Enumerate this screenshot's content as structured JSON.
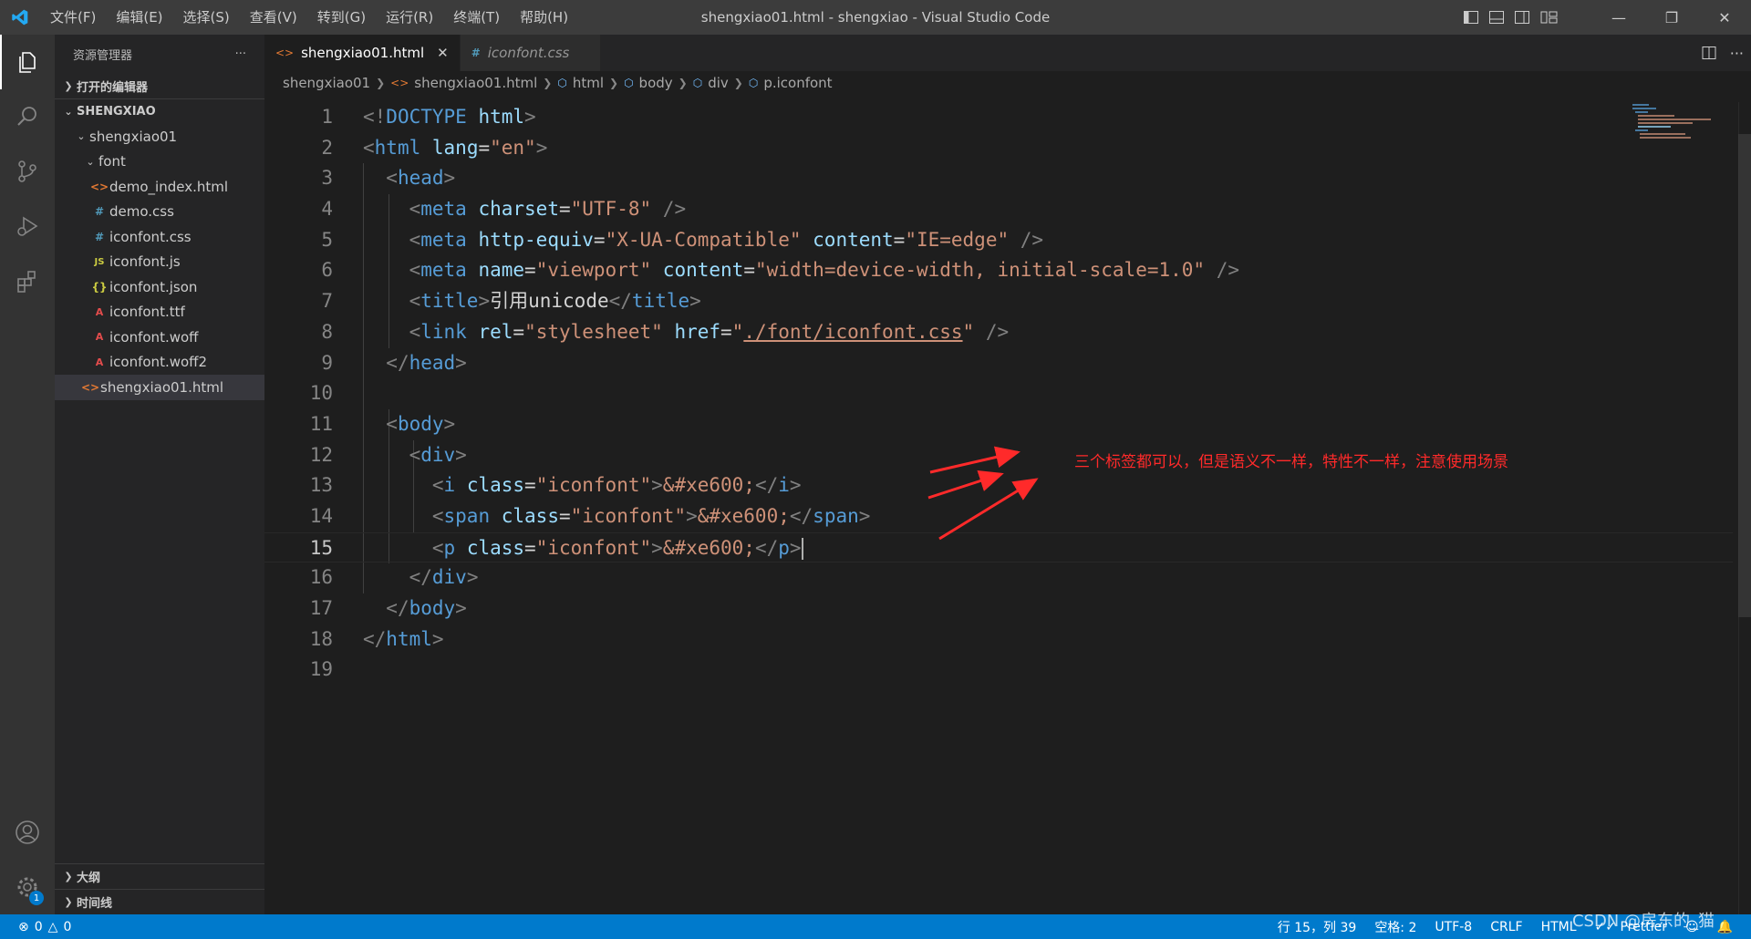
{
  "titlebar": {
    "menu": [
      "文件(F)",
      "编辑(E)",
      "选择(S)",
      "查看(V)",
      "转到(G)",
      "运行(R)",
      "终端(T)",
      "帮助(H)"
    ],
    "window_title": "shengxiao01.html - shengxiao - Visual Studio Code",
    "accent": "#007acc"
  },
  "sidebar": {
    "header": "资源管理器",
    "more": "···",
    "open_editors": "打开的编辑器",
    "workspace": "SHENGXIAO",
    "tree": [
      {
        "label": "shengxiao01",
        "kind": "folder",
        "icon": "chevron-down-icon"
      },
      {
        "label": "font",
        "kind": "folder",
        "icon": "chevron-down-icon"
      },
      {
        "label": "demo_index.html",
        "kind": "file",
        "icon": "html-file-icon",
        "glyph": "<>"
      },
      {
        "label": "demo.css",
        "kind": "file",
        "icon": "css-file-icon",
        "glyph": "#"
      },
      {
        "label": "iconfont.css",
        "kind": "file",
        "icon": "css-file-icon",
        "glyph": "#"
      },
      {
        "label": "iconfont.js",
        "kind": "file",
        "icon": "js-file-icon",
        "glyph": "JS"
      },
      {
        "label": "iconfont.json",
        "kind": "file",
        "icon": "json-file-icon",
        "glyph": "{}"
      },
      {
        "label": "iconfont.ttf",
        "kind": "file",
        "icon": "font-file-icon",
        "glyph": "A"
      },
      {
        "label": "iconfont.woff",
        "kind": "file",
        "icon": "font-file-icon",
        "glyph": "A"
      },
      {
        "label": "iconfont.woff2",
        "kind": "file",
        "icon": "font-file-icon",
        "glyph": "A"
      },
      {
        "label": "shengxiao01.html",
        "kind": "file",
        "icon": "html-file-icon",
        "glyph": "<>"
      }
    ],
    "outline": "大纲",
    "timeline": "时间线"
  },
  "tabs": [
    {
      "label": "shengxiao01.html",
      "glyph": "<>",
      "active": true,
      "close": "✕"
    },
    {
      "label": "iconfont.css",
      "glyph": "#",
      "active": false
    }
  ],
  "breadcrumb": [
    "shengxiao01",
    "shengxiao01.html",
    "html",
    "body",
    "div",
    "p.iconfont"
  ],
  "editor": {
    "line_numbers": [
      "1",
      "2",
      "3",
      "4",
      "5",
      "6",
      "7",
      "8",
      "9",
      "10",
      "11",
      "12",
      "13",
      "14",
      "15",
      "16",
      "17",
      "18",
      "19"
    ],
    "current_line": 15
  },
  "code": {
    "l1": {
      "open": "<!",
      "tag": "DOCTYPE",
      "attr": "html",
      "close": ">"
    },
    "l2": {
      "open": "<",
      "tag": "html",
      "attr": "lang",
      "eq": "=",
      "val": "\"en\"",
      "close": ">"
    },
    "l3": {
      "open": "<",
      "tag": "head",
      "close": ">"
    },
    "l4": {
      "open": "<",
      "tag": "meta",
      "attr": "charset",
      "eq": "=",
      "val": "\"UTF-8\"",
      "close": " />"
    },
    "l5": {
      "open": "<",
      "tag": "meta",
      "attr1": "http-equiv",
      "eq1": "=",
      "val1": "\"X-UA-Compatible\"",
      "attr2": "content",
      "eq2": "=",
      "val2": "\"IE=edge\"",
      "close": " />"
    },
    "l6": {
      "open": "<",
      "tag": "meta",
      "attr1": "name",
      "eq1": "=",
      "val1": "\"viewport\"",
      "attr2": "content",
      "eq2": "=",
      "val2": "\"width=device-width, initial-scale=1.0\"",
      "close": " />"
    },
    "l7": {
      "open": "<",
      "tag": "title",
      "mid": ">",
      "text": "引用unicode",
      "open2": "</",
      "tag2": "title",
      "close": ">"
    },
    "l8": {
      "open": "<",
      "tag": "link",
      "attr1": "rel",
      "eq1": "=",
      "val1": "\"stylesheet\"",
      "attr2": "href",
      "eq2": "=",
      "q1": "\"",
      "href": "./font/iconfont.css",
      "q2": "\"",
      "close": " />"
    },
    "l9": {
      "open": "</",
      "tag": "head",
      "close": ">"
    },
    "l11": {
      "open": "<",
      "tag": "body",
      "close": ">"
    },
    "l12": {
      "open": "<",
      "tag": "div",
      "close": ">"
    },
    "l13": {
      "open": "<",
      "tag": "i",
      "attr": "class",
      "eq": "=",
      "val": "\"iconfont\"",
      "mid": ">",
      "ent": "&#xe600;",
      "open2": "</",
      "tag2": "i",
      "close": ">"
    },
    "l14": {
      "open": "<",
      "tag": "span",
      "attr": "class",
      "eq": "=",
      "val": "\"iconfont\"",
      "mid": ">",
      "ent": "&#xe600;",
      "open2": "</",
      "tag2": "span",
      "close": ">"
    },
    "l15": {
      "open": "<",
      "tag": "p",
      "attr": "class",
      "eq": "=",
      "val": "\"iconfont\"",
      "mid": ">",
      "ent": "&#xe600;",
      "open2": "</",
      "tag2": "p",
      "close": ">"
    },
    "l16": {
      "open": "</",
      "tag": "div",
      "close": ">"
    },
    "l17": {
      "open": "</",
      "tag": "body",
      "close": ">"
    },
    "l18": {
      "open": "</",
      "tag": "html",
      "close": ">"
    }
  },
  "annotation": "三个标签都可以，但是语义不一样，特性不一样，注意使用场景",
  "statusbar": {
    "errors": "0",
    "warnings": "0",
    "position": "行 15，列 39",
    "spaces": "空格: 2",
    "encoding": "UTF-8",
    "eol": "CRLF",
    "language": "HTML",
    "prettier": "Prettier"
  },
  "watermark": "CSDN @房东的_猫",
  "activity_badge": "1"
}
